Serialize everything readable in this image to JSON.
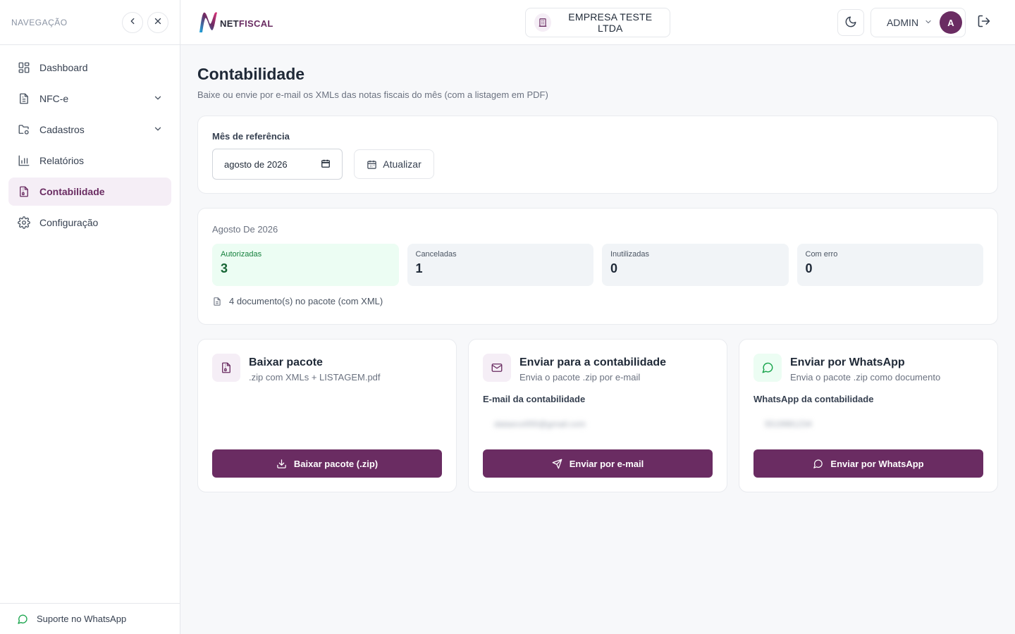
{
  "sidebar": {
    "title": "NAVEGAÇÃO",
    "items": [
      {
        "label": "Dashboard",
        "icon": "grid-icon"
      },
      {
        "label": "NFC-e",
        "icon": "document-icon"
      },
      {
        "label": "Cadastros",
        "icon": "folder-gear-icon"
      },
      {
        "label": "Relatórios",
        "icon": "bar-chart-icon"
      },
      {
        "label": "Contabilidade",
        "icon": "file-zip-icon"
      },
      {
        "label": "Configuração",
        "icon": "gear-icon"
      }
    ],
    "support_label": "Suporte no WhatsApp"
  },
  "topbar": {
    "logo_prefix": "NET",
    "logo_suffix": "FISCAL",
    "company": "EMPRESA TESTE LTDA",
    "user": "ADMIN",
    "avatar_initial": "A"
  },
  "page": {
    "title": "Contabilidade",
    "subtitle": "Baixe ou envie por e-mail os XMLs das notas fiscais do mês (com a listagem em PDF)"
  },
  "reference": {
    "label": "Mês de referência",
    "month_value": "agosto de 2026",
    "refresh_label": "Atualizar"
  },
  "summary": {
    "period": "Agosto De 2026",
    "stats": [
      {
        "label": "Autorizadas",
        "value": "3"
      },
      {
        "label": "Canceladas",
        "value": "1"
      },
      {
        "label": "Inutilizadas",
        "value": "0"
      },
      {
        "label": "Com erro",
        "value": "0"
      }
    ],
    "docs_text": "4 documento(s) no pacote (com XML)"
  },
  "actions": {
    "download": {
      "title": "Baixar pacote",
      "desc": ".zip com XMLs + LISTAGEM.pdf",
      "button": "Baixar pacote (.zip)"
    },
    "email": {
      "title": "Enviar para a contabilidade",
      "desc": "Envia o pacote .zip por e-mail",
      "field_label": "E-mail da contabilidade",
      "field_value": "dataeco000@gmail.com",
      "button": "Enviar por e-mail"
    },
    "whatsapp": {
      "title": "Enviar por WhatsApp",
      "desc": "Envia o pacote .zip como documento",
      "field_label": "WhatsApp da contabilidade",
      "field_value": "5519981234",
      "button": "Enviar por WhatsApp"
    }
  },
  "colors": {
    "brand": "#6a2c62",
    "success_bg": "#ecfdf3",
    "success_text": "#166534"
  }
}
